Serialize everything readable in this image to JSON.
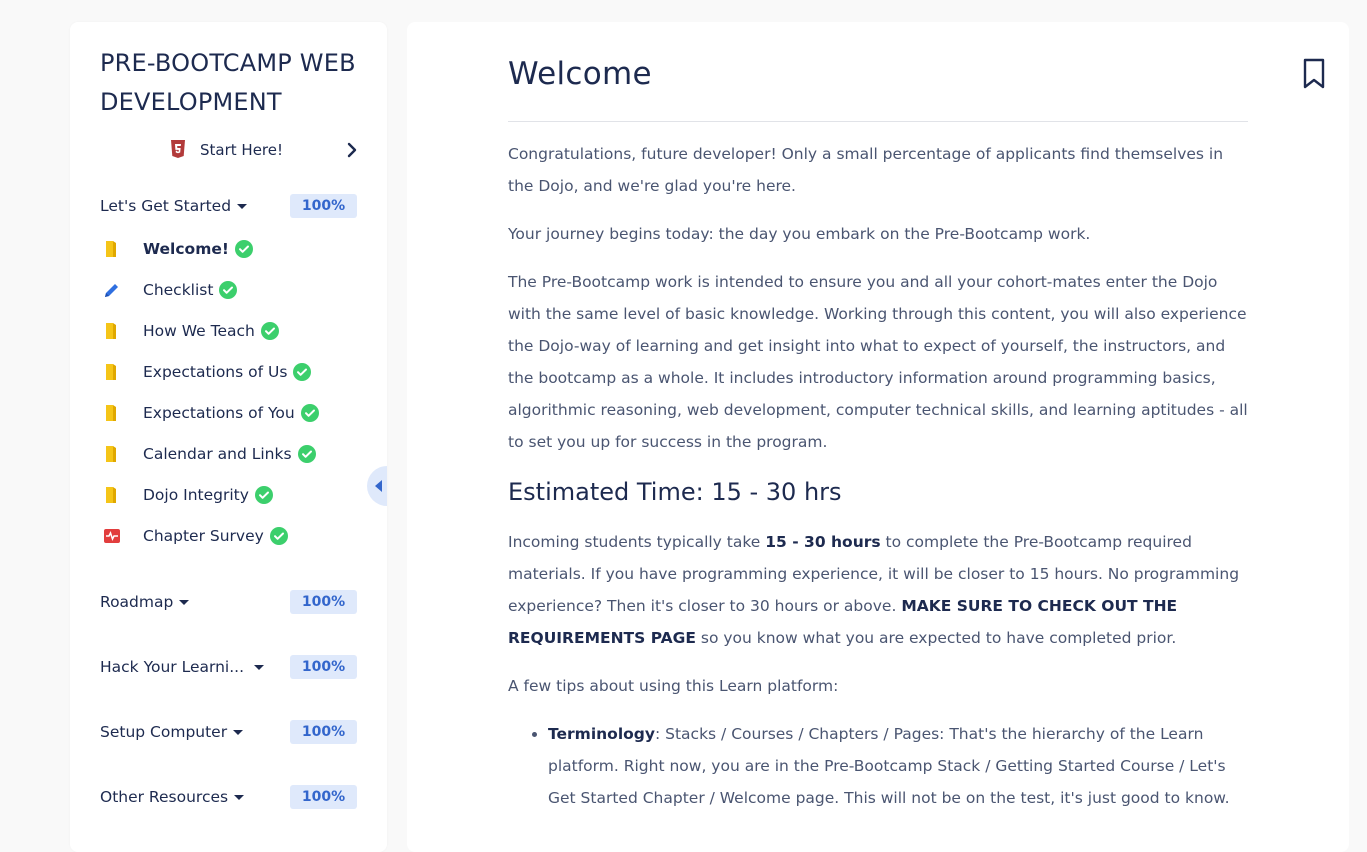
{
  "sidebar": {
    "course_title": "PRE-BOOTCAMP WEB DEVELOPMENT",
    "start_here": "Start Here!",
    "chapters": [
      {
        "label": "Let's Get Started",
        "progress": "100%",
        "pages": [
          {
            "label": "Welcome!",
            "icon": "book-icon",
            "completed": true,
            "active": true
          },
          {
            "label": "Checklist",
            "icon": "pencil-icon",
            "completed": true
          },
          {
            "label": "How We Teach",
            "icon": "book-icon",
            "completed": true
          },
          {
            "label": "Expectations of Us",
            "icon": "book-icon",
            "completed": true
          },
          {
            "label": "Expectations of You",
            "icon": "book-icon",
            "completed": true
          },
          {
            "label": "Calendar and Links",
            "icon": "book-icon",
            "completed": true
          },
          {
            "label": "Dojo Integrity",
            "icon": "book-icon",
            "completed": true
          },
          {
            "label": "Chapter Survey",
            "icon": "survey-icon",
            "completed": true
          }
        ]
      },
      {
        "label": "Roadmap",
        "progress": "100%"
      },
      {
        "label": "Hack Your Learni...",
        "progress": "100%"
      },
      {
        "label": "Setup Computer",
        "progress": "100%"
      },
      {
        "label": "Other Resources",
        "progress": "100%"
      }
    ]
  },
  "main": {
    "heading": "Welcome",
    "p1": "Congratulations, future developer! Only a small percentage of applicants find themselves in the Dojo, and we're glad you're here.",
    "p2": "Your journey begins today: the day you embark on the Pre-Bootcamp work.",
    "p3": "The Pre-Bootcamp work is intended to ensure you and all your cohort-mates enter the Dojo with the same level of basic knowledge. Working through this content, you will also experience the Dojo-way of learning and get insight into what to expect of yourself, the instructors, and the bootcamp as a whole. It includes introductory information around programming basics, algorithmic reasoning, web development, computer technical skills, and learning aptitudes - all to set you up for success in the program.",
    "estimated_heading": "Estimated Time: 15 - 30 hrs",
    "p4_a": "Incoming students typically take ",
    "p4_bold1": "15 - 30 hours",
    "p4_b": " to complete the Pre-Bootcamp required materials. If you have programming experience, it will be closer to 15 hours. No programming experience? Then it's closer to 30 hours or above. ",
    "p4_bold2": "MAKE SURE TO CHECK OUT THE REQUIREMENTS PAGE",
    "p4_c": " so you know what you are expected to have completed prior.",
    "p5": "A few tips about using this Learn platform:",
    "tip1_bold": "Terminology",
    "tip1_text": ": Stacks / Courses / Chapters / Pages: That's the hierarchy of the Learn platform. Right now, you are in the Pre-Bootcamp Stack / Getting Started Course / Let's Get Started Chapter / Welcome page. This will not be on the test, it's just good to know."
  },
  "colors": {
    "primary_text": "#1d2a4f",
    "body_text": "#4a5571",
    "badge_bg": "#dfe9fb",
    "badge_text": "#3366cc",
    "check_green": "#3ccf6c",
    "book_yellow": "#f5c518"
  }
}
